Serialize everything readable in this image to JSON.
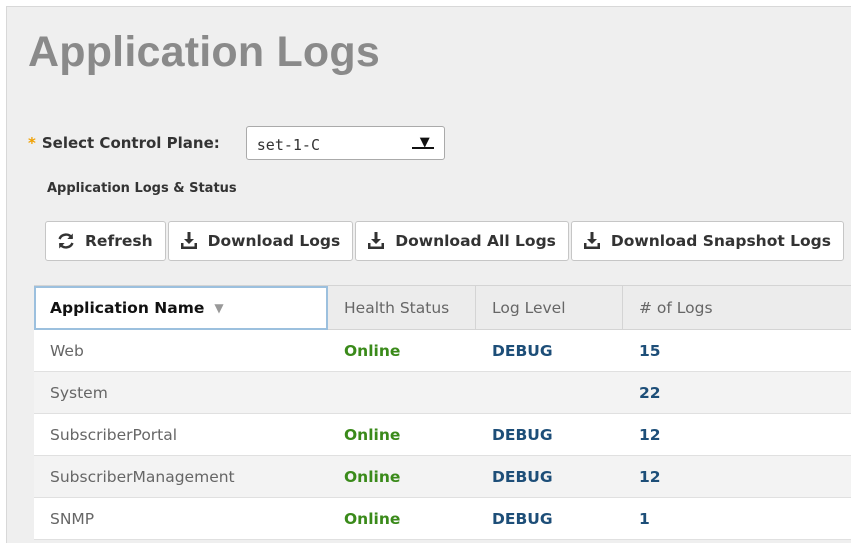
{
  "page": {
    "title": "Application Logs"
  },
  "control_plane": {
    "required_marker": "*",
    "label": "Select Control Plane:",
    "selected": "set-1-C"
  },
  "section": {
    "title": "Application Logs & Status"
  },
  "toolbar": {
    "buttons": [
      {
        "label": "Refresh",
        "icon": "refresh-icon"
      },
      {
        "label": "Download Logs",
        "icon": "download-icon"
      },
      {
        "label": "Download All Logs",
        "icon": "download-icon"
      },
      {
        "label": "Download Snapshot Logs",
        "icon": "download-icon"
      }
    ]
  },
  "table": {
    "columns": [
      "Application Name",
      "Health Status",
      "Log Level",
      "# of Logs"
    ],
    "sort_icon": "caret-down-icon",
    "rows": [
      {
        "name": "Web",
        "health": "Online",
        "level": "DEBUG",
        "count": "15"
      },
      {
        "name": "System",
        "health": "",
        "level": "",
        "count": "22"
      },
      {
        "name": "SubscriberPortal",
        "health": "Online",
        "level": "DEBUG",
        "count": "12"
      },
      {
        "name": "SubscriberManagement",
        "health": "Online",
        "level": "DEBUG",
        "count": "12"
      },
      {
        "name": "SNMP",
        "health": "Online",
        "level": "DEBUG",
        "count": "1"
      }
    ]
  },
  "colors": {
    "title": "#8a8a8a",
    "online": "#3a8a1a",
    "debug": "#1d4e78",
    "required": "#f0a000"
  }
}
